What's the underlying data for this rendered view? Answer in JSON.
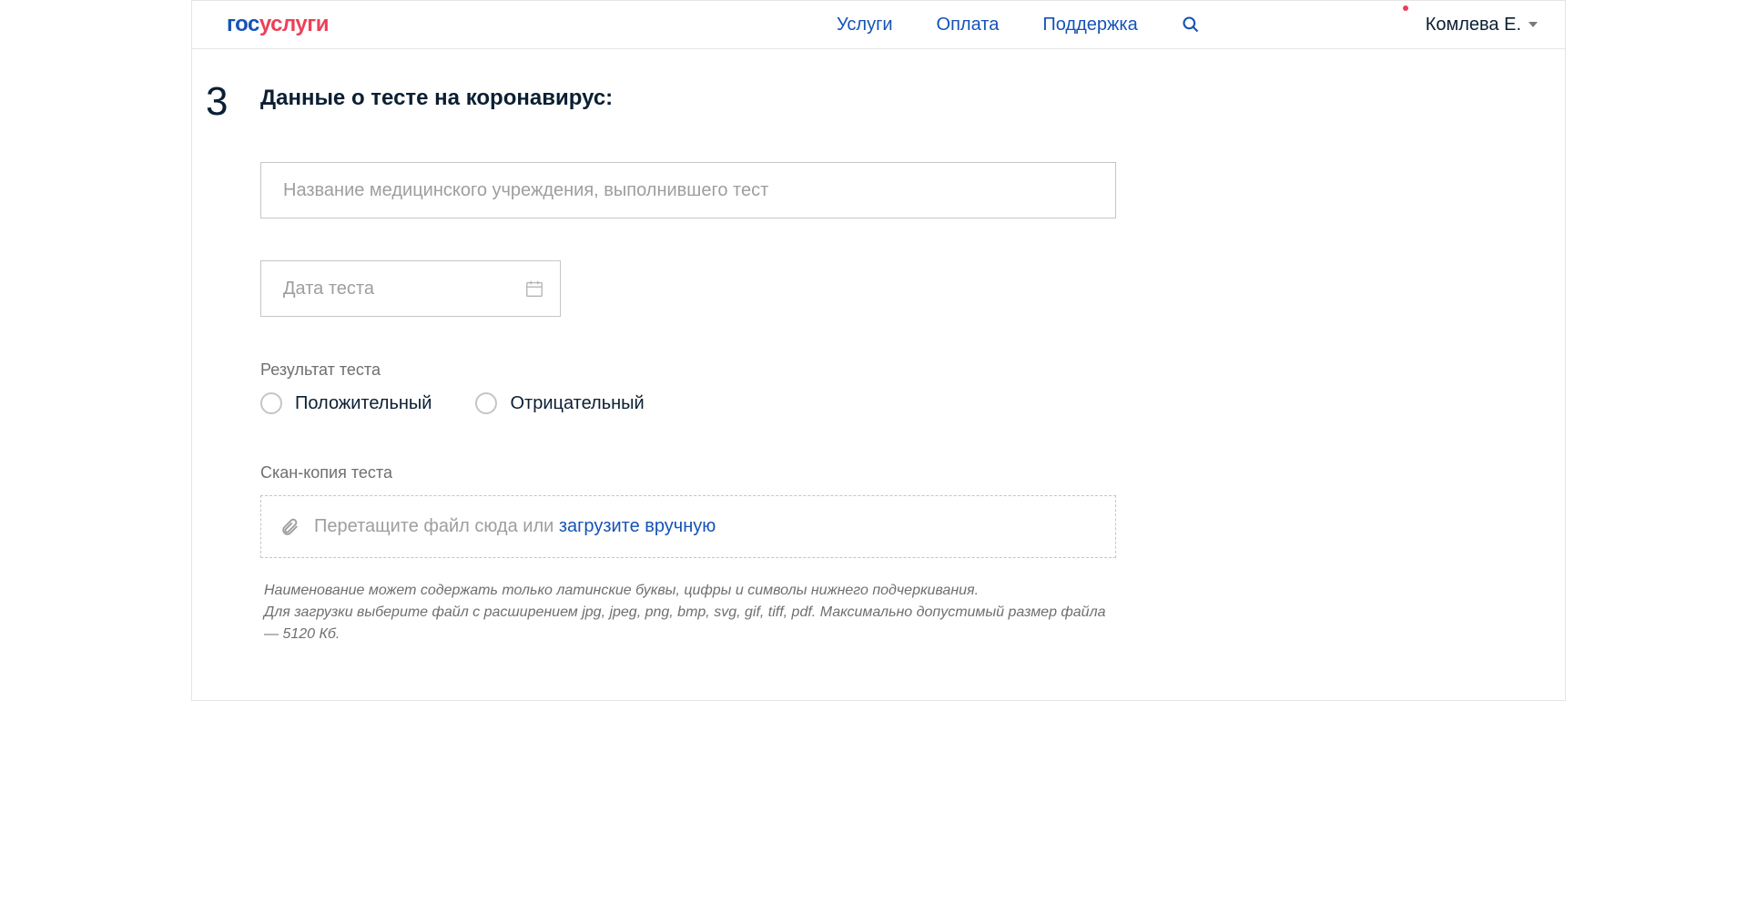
{
  "header": {
    "logo_gos": "гос",
    "logo_uslugi": "услуги",
    "nav": {
      "services": "Услуги",
      "payment": "Оплата",
      "support": "Поддержка"
    },
    "user_name": "Комлева Е."
  },
  "step": {
    "number": "3",
    "title": "Данные о тесте на коронавирус:"
  },
  "form": {
    "institution_placeholder": "Название медицинского учреждения, выполнившего тест",
    "date_placeholder": "Дата теста",
    "result_label": "Результат теста",
    "result_positive": "Положительный",
    "result_negative": "Отрицательный",
    "scan_label": "Скан-копия теста",
    "drop_text": "Перетащите файл сюда или ",
    "drop_link": "загрузите вручную",
    "hint_line1": "Наименование может содержать только латинские буквы, цифры и символы нижнего подчеркивания.",
    "hint_line2": "Для загрузки выберите файл с расширением jpg, jpeg, png, bmp, svg, gif, tiff, pdf. Максимально допустимый размер файла — 5120 Кб."
  }
}
